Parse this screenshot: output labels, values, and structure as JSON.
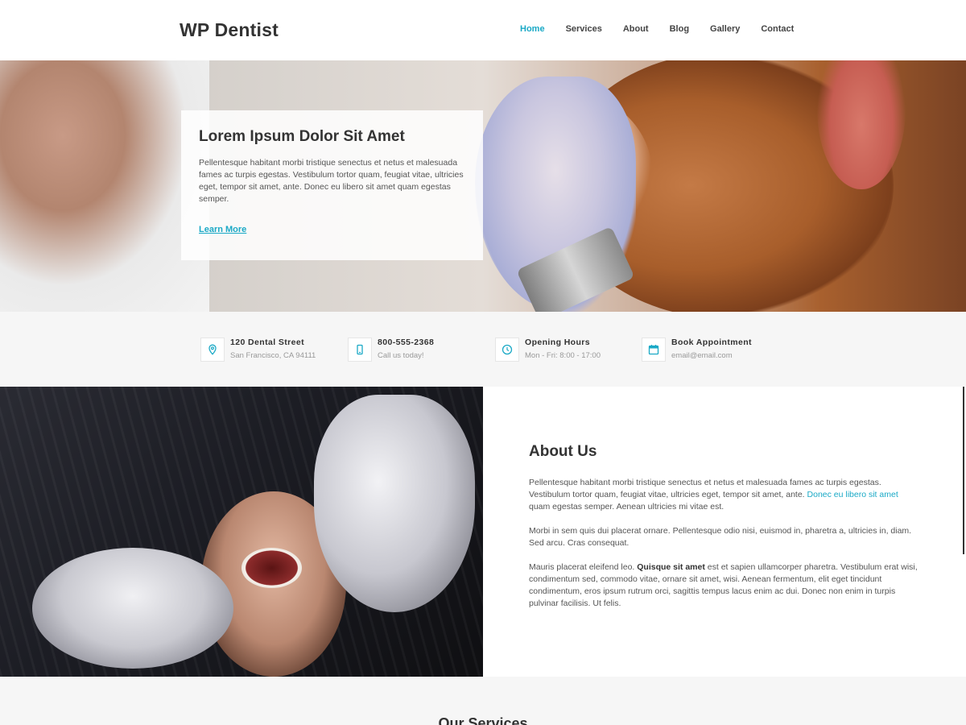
{
  "site": {
    "logo": "WP Dentist"
  },
  "nav": {
    "items": [
      {
        "label": "Home",
        "active": true
      },
      {
        "label": "Services"
      },
      {
        "label": "About"
      },
      {
        "label": "Blog"
      },
      {
        "label": "Gallery"
      },
      {
        "label": "Contact"
      }
    ]
  },
  "hero": {
    "title": "Lorem Ipsum Dolor Sit Amet",
    "text": "Pellentesque habitant morbi tristique senectus et netus et malesuada fames ac turpis egestas. Vestibulum tortor quam, feugiat vitae, ultricies eget, tempor sit amet, ante. Donec eu libero sit amet quam egestas semper.",
    "cta": "Learn More"
  },
  "info": [
    {
      "icon": "map-pin-icon",
      "title": "120 Dental Street",
      "sub": "San Francisco, CA 94111"
    },
    {
      "icon": "phone-icon",
      "title": "800-555-2368",
      "sub": "Call us today!"
    },
    {
      "icon": "clock-icon",
      "title": "Opening Hours",
      "sub": "Mon - Fri: 8:00 - 17:00"
    },
    {
      "icon": "calendar-icon",
      "title": "Book Appointment",
      "sub": "email@email.com"
    }
  ],
  "about": {
    "title": "About Us",
    "p1_a": "Pellentesque habitant morbi tristique senectus et netus et malesuada fames ac turpis egestas. Vestibulum tortor quam, feugiat vitae, ultricies eget, tempor sit amet, ante. ",
    "p1_link": "Donec eu libero sit amet",
    "p1_b": " quam egestas semper. Aenean ultricies mi vitae est.",
    "p2": "Morbi in sem quis dui placerat ornare. Pellentesque odio nisi, euismod in, pharetra a, ultricies in, diam. Sed arcu. Cras consequat.",
    "p3_a": "Mauris placerat eleifend leo. ",
    "p3_bold": "Quisque sit amet",
    "p3_b": " est et sapien ullamcorper pharetra. Vestibulum erat wisi, condimentum sed, commodo vitae, ornare sit amet, wisi. Aenean fermentum, elit eget tincidunt condimentum, eros ipsum rutrum orci, sagittis tempus lacus enim ac dui. Donec non enim in turpis pulvinar facilisis. Ut felis."
  },
  "services": {
    "title": "Our Services"
  },
  "colors": {
    "accent": "#1aa9c6",
    "heading": "#333333",
    "text": "#555555",
    "muted": "#999999",
    "band": "#f6f6f6"
  }
}
